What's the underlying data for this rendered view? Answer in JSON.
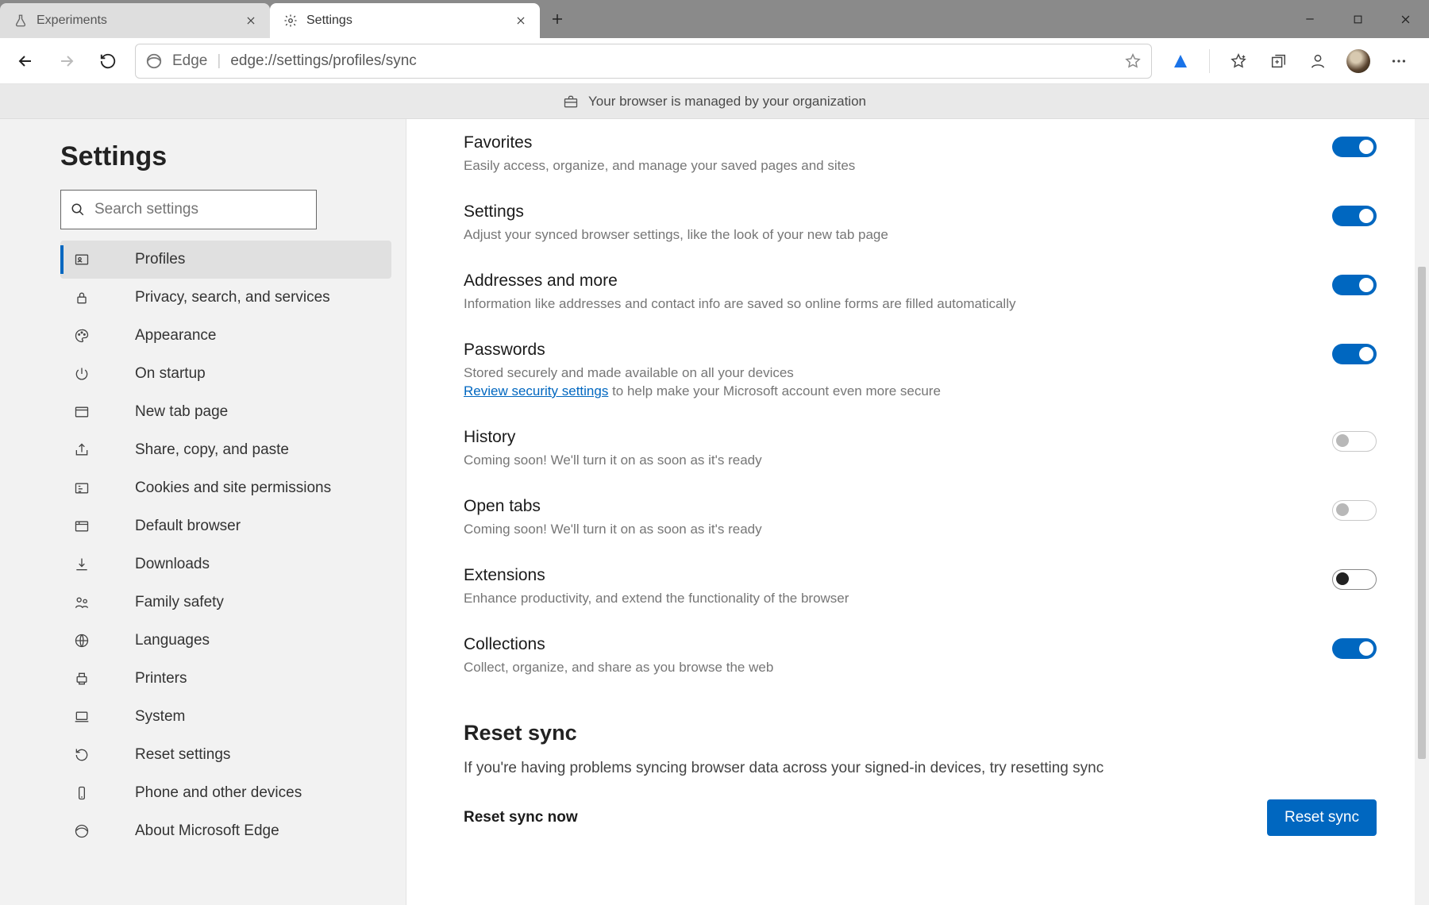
{
  "tabs": [
    {
      "title": "Experiments",
      "icon": "flask"
    },
    {
      "title": "Settings",
      "icon": "gear"
    }
  ],
  "omnibox": {
    "label": "Edge",
    "url": "edge://settings/profiles/sync"
  },
  "banner": {
    "text": "Your browser is managed by your organization"
  },
  "sidebar": {
    "heading": "Settings",
    "search_placeholder": "Search settings",
    "items": [
      {
        "label": "Profiles"
      },
      {
        "label": "Privacy, search, and services"
      },
      {
        "label": "Appearance"
      },
      {
        "label": "On startup"
      },
      {
        "label": "New tab page"
      },
      {
        "label": "Share, copy, and paste"
      },
      {
        "label": "Cookies and site permissions"
      },
      {
        "label": "Default browser"
      },
      {
        "label": "Downloads"
      },
      {
        "label": "Family safety"
      },
      {
        "label": "Languages"
      },
      {
        "label": "Printers"
      },
      {
        "label": "System"
      },
      {
        "label": "Reset settings"
      },
      {
        "label": "Phone and other devices"
      },
      {
        "label": "About Microsoft Edge"
      }
    ]
  },
  "sync": {
    "favorites": {
      "title": "Favorites",
      "desc": "Easily access, organize, and manage your saved pages and sites"
    },
    "settings": {
      "title": "Settings",
      "desc": "Adjust your synced browser settings, like the look of your new tab page"
    },
    "addresses": {
      "title": "Addresses and more",
      "desc": "Information like addresses and contact info are saved so online forms are filled automatically"
    },
    "passwords": {
      "title": "Passwords",
      "desc": "Stored securely and made available on all your devices",
      "link": "Review security settings",
      "desc2": " to help make your Microsoft account even more secure"
    },
    "history": {
      "title": "History",
      "desc": "Coming soon! We'll turn it on as soon as it's ready"
    },
    "opentabs": {
      "title": "Open tabs",
      "desc": "Coming soon! We'll turn it on as soon as it's ready"
    },
    "extensions": {
      "title": "Extensions",
      "desc": "Enhance productivity, and extend the functionality of the browser"
    },
    "collections": {
      "title": "Collections",
      "desc": "Collect, organize, and share as you browse the web"
    }
  },
  "reset": {
    "heading": "Reset sync",
    "desc": "If you're having problems syncing browser data across your signed-in devices, try resetting sync",
    "row_label": "Reset sync now",
    "button": "Reset sync"
  }
}
